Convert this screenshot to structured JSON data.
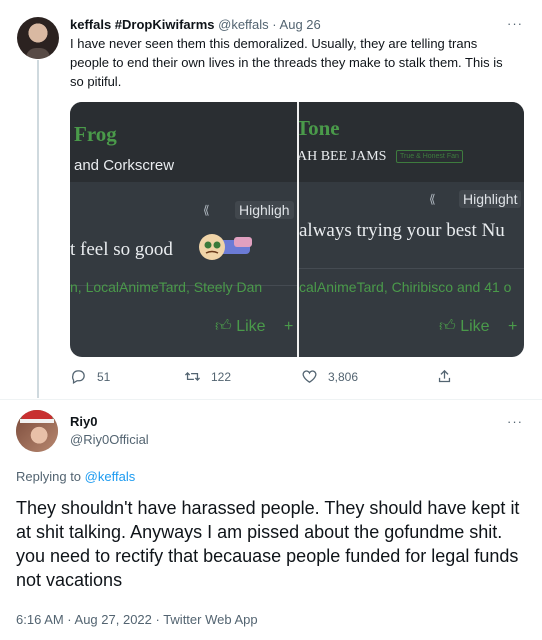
{
  "first_tweet": {
    "display_name": "keffals #DropKiwifarms",
    "handle": "@keffals",
    "separator": "·",
    "date": "Aug 26",
    "more": "···",
    "text": "I have never seen them this demoralized. Usually, they are telling trans people to end their own lives in the threads they make to stalk them. This is so pitiful.",
    "media": {
      "left": {
        "title": "Frog",
        "subtitle": "and Corkscrew",
        "rewind_glyph": "⟪",
        "highlight_label": "Highligh",
        "post_text": "t feel so good",
        "reactors": "n, LocalAnimeTard, Steely Dan",
        "like_label": "Like",
        "plus": "+"
      },
      "right": {
        "title": "Tone",
        "subtitle": "AH BEE JAMS",
        "badge": "True & Honest Fan",
        "rewind_glyph": "⟪",
        "highlight_label": "Highlight",
        "post_text": "always trying your best Nu",
        "reactors": "calAnimeTard, Chiribisco and 41 o",
        "like_label": "Like",
        "plus": "+"
      }
    },
    "actions": {
      "replies": "51",
      "retweets": "122",
      "likes": "3,806"
    }
  },
  "second_tweet": {
    "display_name": "Riy0",
    "handle": "@Riy0Official",
    "more": "···",
    "replying_prefix": "Replying to",
    "replying_handle": "@keffals",
    "text": "They shouldn't have harassed people. They should have kept it at shit talking. Anyways I am pissed about the gofundme shit. you need to rectify that becauase people funded for legal funds not vacations",
    "timestamp": "6:16 AM · Aug 27, 2022 · Twitter Web App"
  },
  "colors": {
    "accent_link": "#1d9bf0",
    "secondary_text": "#536471",
    "forum_green": "#4a9a4a",
    "forum_dark": "#343a40"
  }
}
